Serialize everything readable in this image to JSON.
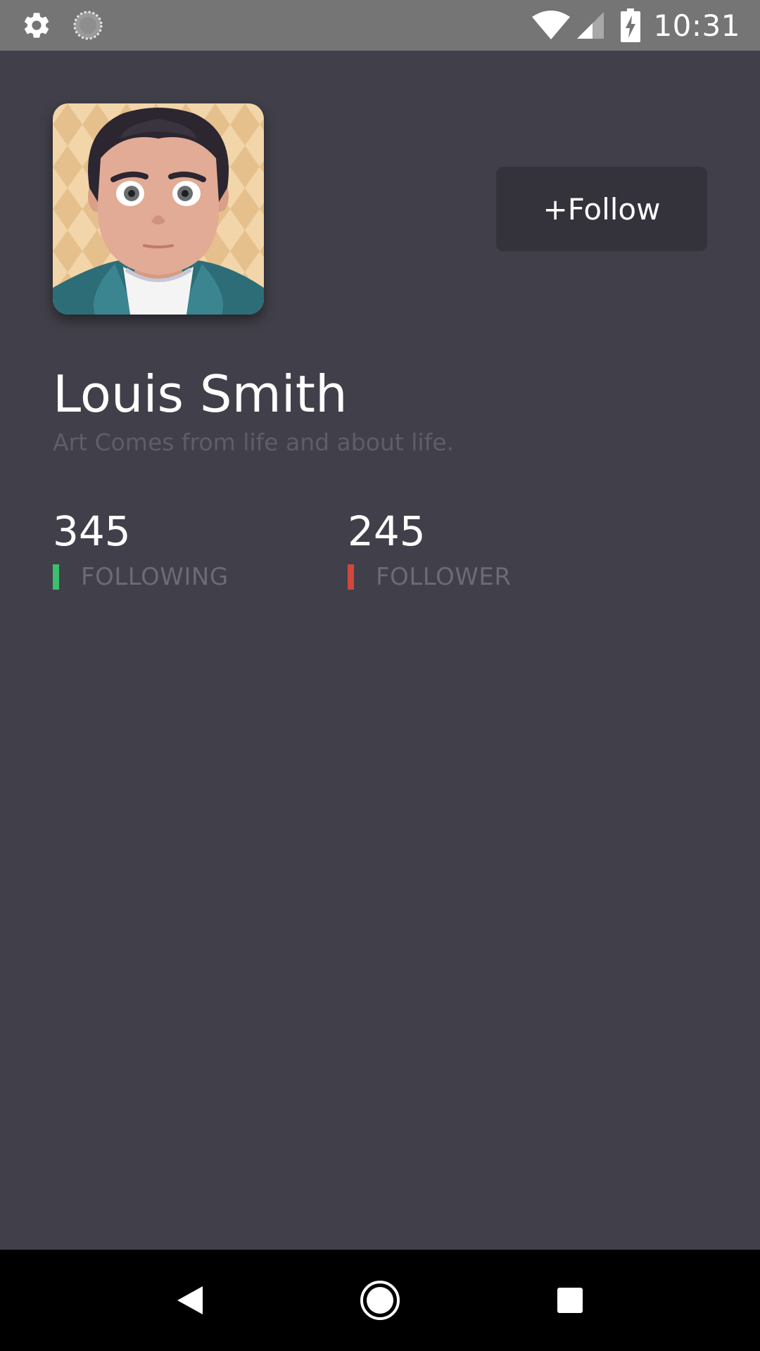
{
  "status_bar": {
    "time": "10:31",
    "icons": [
      "gear-icon",
      "loading-spinner-icon",
      "wifi-icon",
      "cellular-signal-icon",
      "battery-charging-icon"
    ]
  },
  "profile": {
    "avatar_icon": "cartoon-man-avatar",
    "follow_label": "+Follow",
    "name": "Louis Smith",
    "bio": "Art Comes from life and about life."
  },
  "stats": {
    "following": {
      "count": "345",
      "label": "FOLLOWING",
      "accent": "#3dbf6e"
    },
    "follower": {
      "count": "245",
      "label": "FOLLOWER",
      "accent": "#d2473b"
    }
  },
  "nav_bar": {
    "icons": [
      "back-icon",
      "home-icon",
      "recents-icon"
    ]
  },
  "colors": {
    "background": "#41404a",
    "button": "#34333c",
    "status_bar": "#757575",
    "nav_bar": "#000000"
  }
}
